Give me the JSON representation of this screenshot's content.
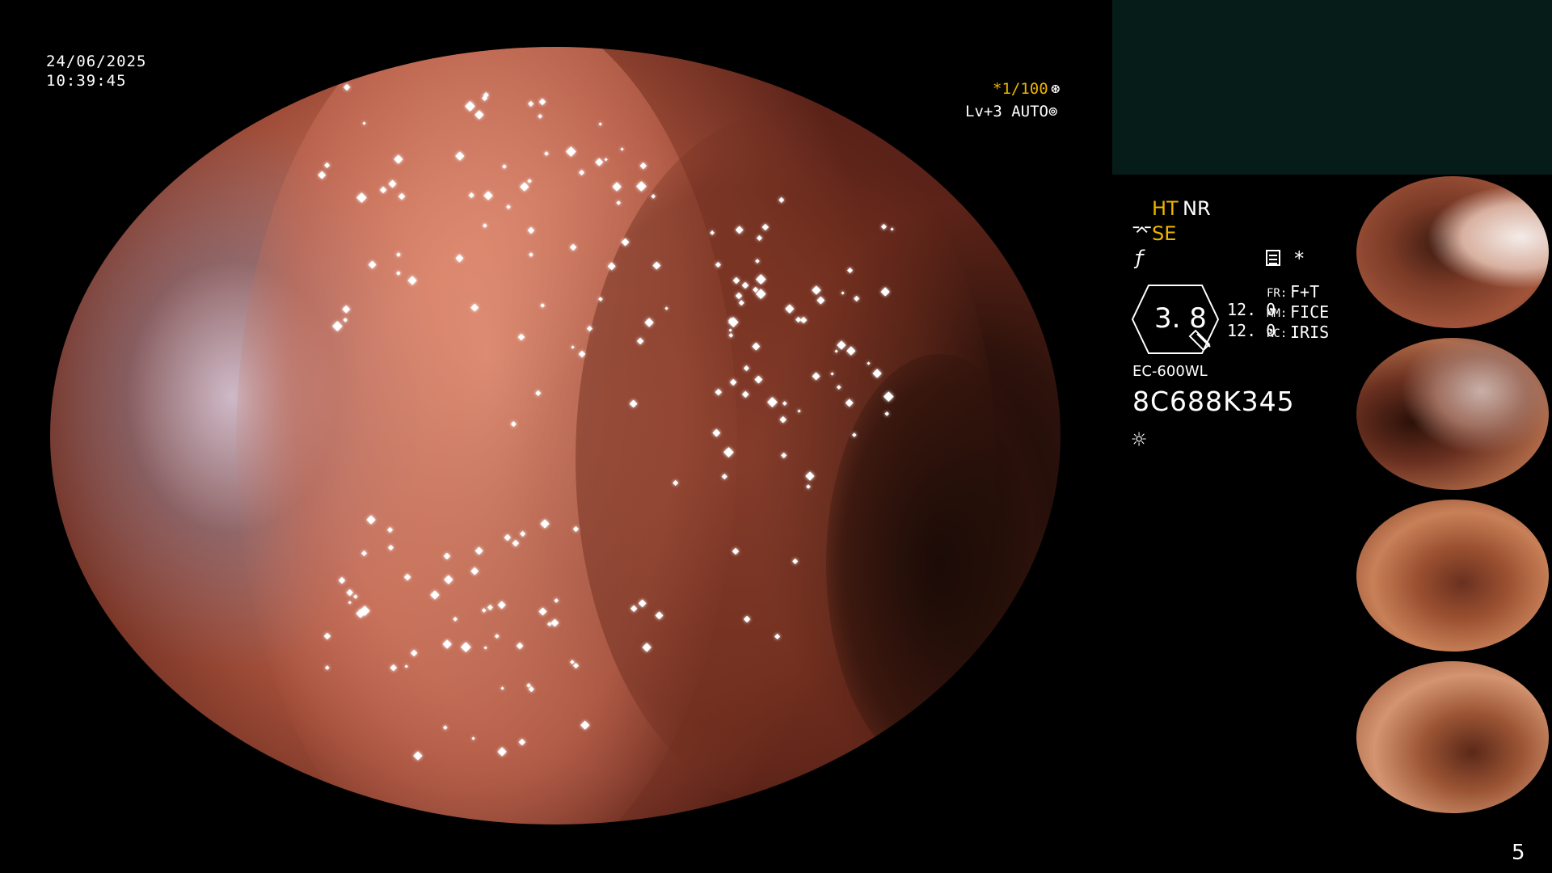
{
  "overlay": {
    "date": "24/06/2025",
    "time": "10:39:45",
    "shutter": "*1/100",
    "level": "Lv+3 AUTO"
  },
  "status": {
    "ht": "HT",
    "nr": "NR",
    "se": "SE",
    "star": "*",
    "hex_value": "3. 8",
    "value_a": "12. 0",
    "value_b": "12. 0",
    "fr_label": "FR:",
    "fr_value": "F+T",
    "mm_label": "MM:",
    "mm_value": "FICE",
    "rc_label": "RC:",
    "rc_value": "IRIS"
  },
  "device": {
    "model": "EC-600WL",
    "serial": "8C688K345"
  },
  "icons": {
    "shutter": "aperture-icon",
    "auto": "auto-iris-icon",
    "se": "enhancement-icon",
    "f": "f-icon",
    "list": "list-icon",
    "sun": "brightness-icon"
  },
  "thumbnails": [
    "capture-1",
    "capture-2",
    "capture-3",
    "capture-4"
  ],
  "page_number": "5"
}
